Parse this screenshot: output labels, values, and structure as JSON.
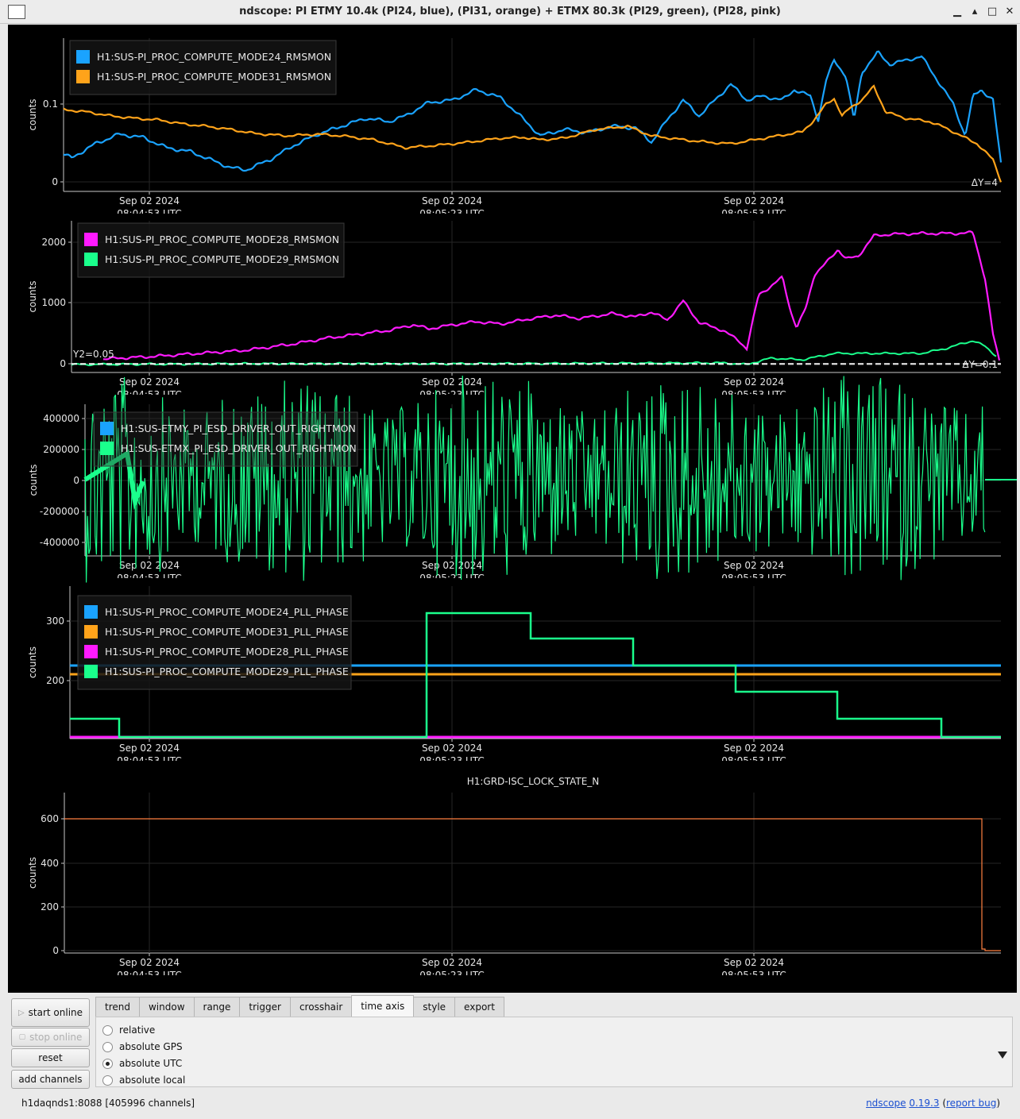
{
  "window": {
    "title": "ndscope: PI ETMY 10.4k (PI24, blue), (PI31, orange) + ETMX 80.3k (PI29, green), (PI28, pink)",
    "min_icon": "minimize-icon",
    "max_icon": "maximize-icon",
    "close_icon": "close-icon"
  },
  "time_ticks": [
    {
      "date": "Sep 02 2024",
      "time": "08:04:53 UTC"
    },
    {
      "date": "Sep 02 2024",
      "time": "08:05:23 UTC"
    },
    {
      "date": "Sep 02 2024",
      "time": "08:05:53 UTC"
    }
  ],
  "colors": {
    "blue": "#1aa3ff",
    "orange": "#ffa31a",
    "magenta": "#ff1aff",
    "green": "#1aff8c",
    "lock": "#ff8040"
  },
  "plots": [
    {
      "ylabel": "counts",
      "yticks": [
        "0.1",
        "0"
      ],
      "legend": [
        "H1:SUS-PI_PROC_COMPUTE_MODE24_RMSMON",
        "H1:SUS-PI_PROC_COMPUTE_MODE31_RMSMON"
      ],
      "annotations": [
        "ΔY=4"
      ]
    },
    {
      "ylabel": "counts",
      "yticks": [
        "2000",
        "1000",
        "0"
      ],
      "legend": [
        "H1:SUS-PI_PROC_COMPUTE_MODE28_RMSMON",
        "H1:SUS-PI_PROC_COMPUTE_MODE29_RMSMON"
      ],
      "annotations": [
        "Y2=0.05",
        "ΔY=0.1"
      ]
    },
    {
      "ylabel": "counts",
      "yticks": [
        "400000",
        "200000",
        "0",
        "-200000",
        "-400000"
      ],
      "legend": [
        "H1:SUS-ETMY_PI_ESD_DRIVER_OUT_RIGHTMON",
        "H1:SUS-ETMX_PI_ESD_DRIVER_OUT_RIGHTMON"
      ]
    },
    {
      "ylabel": "counts",
      "yticks": [
        "300",
        "200"
      ],
      "legend": [
        "H1:SUS-PI_PROC_COMPUTE_MODE24_PLL_PHASE",
        "H1:SUS-PI_PROC_COMPUTE_MODE31_PLL_PHASE",
        "H1:SUS-PI_PROC_COMPUTE_MODE28_PLL_PHASE",
        "H1:SUS-PI_PROC_COMPUTE_MODE29_PLL_PHASE"
      ]
    },
    {
      "title": "H1:GRD-ISC_LOCK_STATE_N",
      "ylabel": "counts",
      "yticks": [
        "600",
        "400",
        "200",
        "0"
      ]
    }
  ],
  "controls": {
    "start_online": "start online",
    "stop_online": "stop online",
    "reset": "reset",
    "add_channels": "add channels",
    "tabs": [
      "trend",
      "window",
      "range",
      "trigger",
      "crosshair",
      "time axis",
      "style",
      "export"
    ],
    "active_tab": "time axis",
    "radios": [
      "relative",
      "absolute GPS",
      "absolute UTC",
      "absolute local"
    ],
    "selected_radio": "absolute UTC",
    "status": "h1daqnds1:8088  [405996 channels]",
    "version_app": "ndscope",
    "version_num": "0.19.3",
    "report_bug": "report bug",
    "collapse_icon": "collapse-arrow-icon",
    "play_icon": "play-icon",
    "stop_icon": "stop-icon"
  }
}
